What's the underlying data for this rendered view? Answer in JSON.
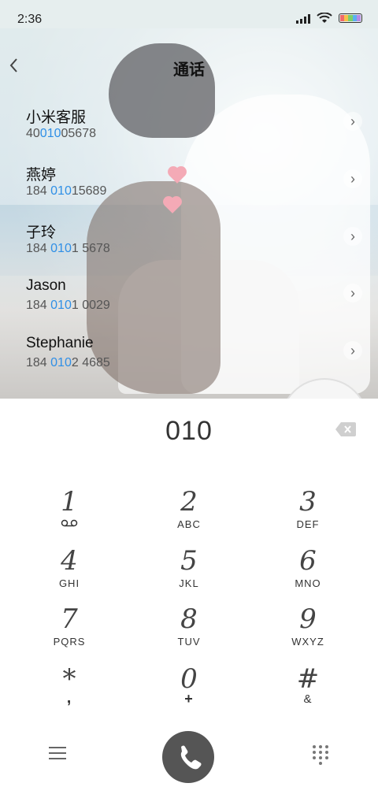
{
  "status": {
    "time": "2:36"
  },
  "header": {
    "title": "通话",
    "back_icon": "chevron-left-icon"
  },
  "contacts": [
    {
      "name": "小米客服",
      "num_pre": "40",
      "num_hl": "010",
      "num_post": "05678"
    },
    {
      "name": "燕婷",
      "num_pre": "184 ",
      "num_hl": "010",
      "num_post": "15689"
    },
    {
      "name": "子玲",
      "num_pre": "184 ",
      "num_hl": "010",
      "num_post": "1 5678"
    },
    {
      "name": "Jason",
      "num_pre": "184 ",
      "num_hl": "010",
      "num_post": "1 0029"
    },
    {
      "name": "Stephanie",
      "num_pre": "184 ",
      "num_hl": "010",
      "num_post": "2 4685"
    }
  ],
  "dialer": {
    "input": "010",
    "keys": [
      {
        "num": "1",
        "sub": "voicemail-icon"
      },
      {
        "num": "2",
        "sub": "ABC"
      },
      {
        "num": "3",
        "sub": "DEF"
      },
      {
        "num": "4",
        "sub": "GHI"
      },
      {
        "num": "5",
        "sub": "JKL"
      },
      {
        "num": "6",
        "sub": "MNO"
      },
      {
        "num": "7",
        "sub": "PQRS"
      },
      {
        "num": "8",
        "sub": "TUV"
      },
      {
        "num": "9",
        "sub": "WXYZ"
      },
      {
        "num": "*",
        "sub": ","
      },
      {
        "num": "0",
        "sub": "+"
      },
      {
        "num": "#",
        "sub": "&"
      }
    ]
  },
  "colors": {
    "highlight": "#2f8fe6",
    "call_button": "#555555"
  }
}
